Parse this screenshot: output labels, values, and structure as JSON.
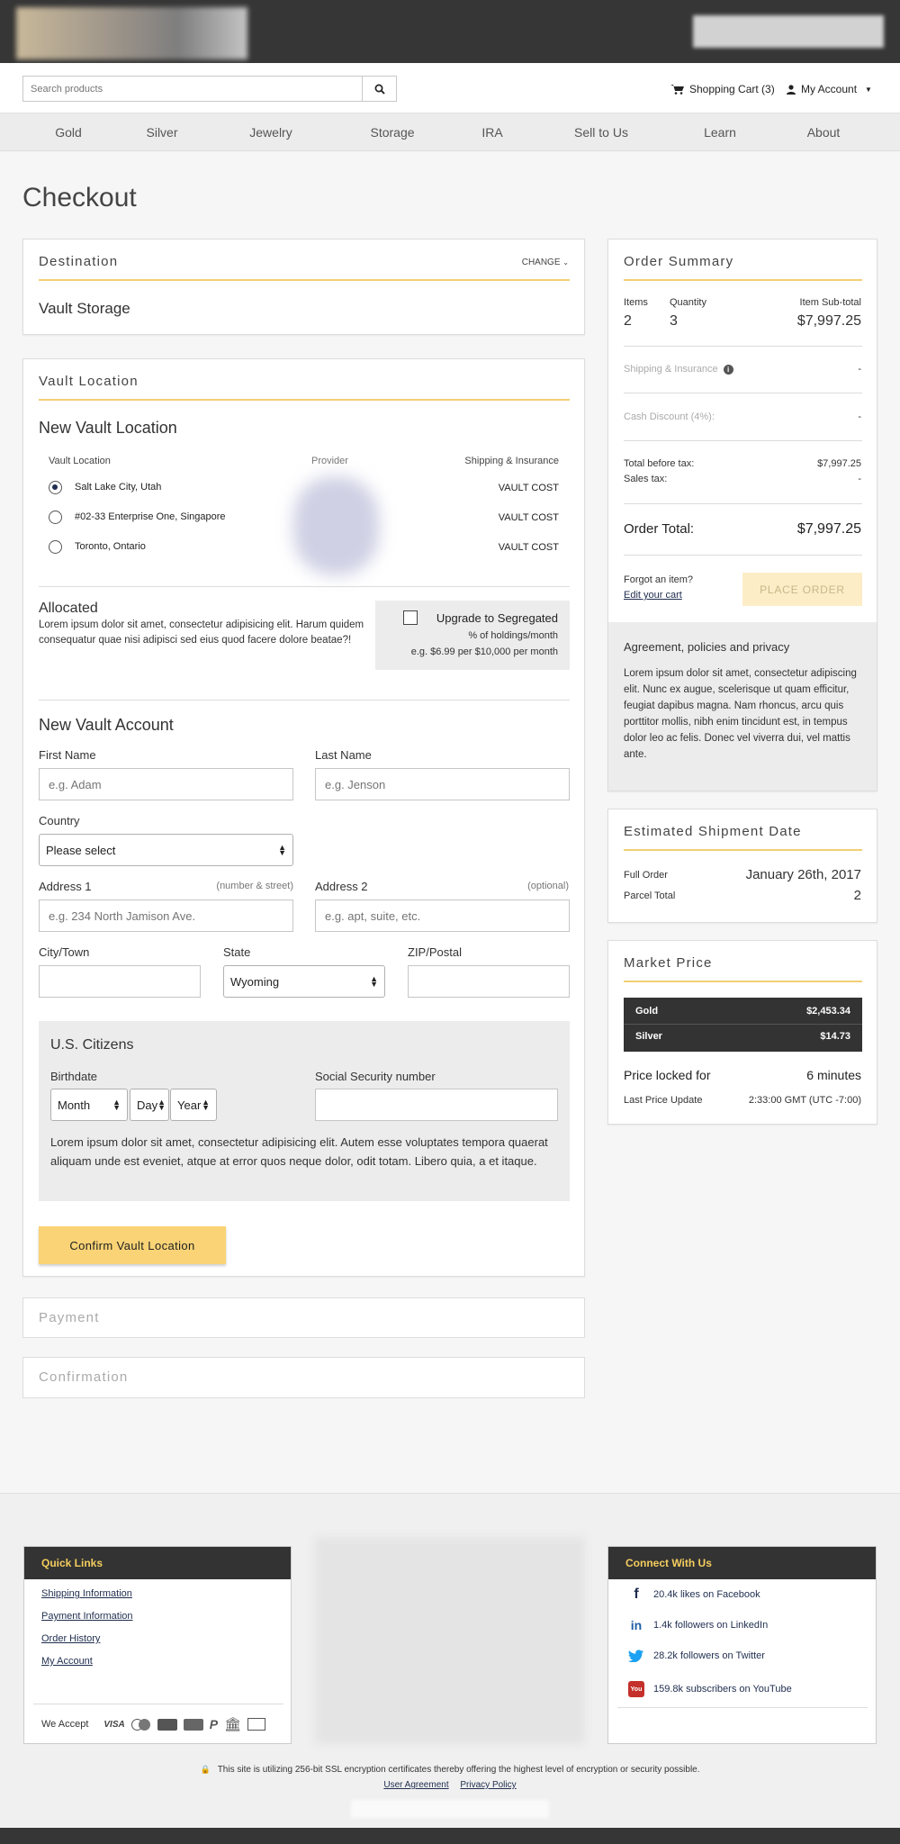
{
  "header": {
    "search_placeholder": "Search products",
    "cart_label": "Shopping Cart (3)",
    "account_label": "My Account"
  },
  "nav": [
    "Gold",
    "Silver",
    "Jewelry",
    "Storage",
    "IRA",
    "Sell to Us",
    "Learn",
    "About"
  ],
  "page_title": "Checkout",
  "destination": {
    "title": "Destination",
    "change_label": "CHANGE",
    "value": "Vault Storage"
  },
  "vault": {
    "title": "Vault Location",
    "subtitle": "New Vault Location",
    "col_location": "Vault Location",
    "col_provider": "Provider",
    "col_shipping": "Shipping & Insurance",
    "locations": [
      {
        "name": "Salt Lake City, Utah",
        "cost": "VAULT COST",
        "selected": true
      },
      {
        "name": "#02-33 Enterprise One, Singapore",
        "cost": "VAULT COST",
        "selected": false
      },
      {
        "name": "Toronto, Ontario",
        "cost": "VAULT COST",
        "selected": false
      }
    ],
    "allocated_title": "Allocated",
    "allocated_text": "Lorem ipsum dolor sit amet, consectetur adipisicing elit. Harum quidem consequatur quae nisi adipisci sed eius quod facere dolore beatae?!",
    "upgrade_label": "Upgrade to Segregated",
    "upgrade_line1": "% of holdings/month",
    "upgrade_line2": "e.g. $6.99 per $10,000 per month"
  },
  "account": {
    "title": "New Vault Account",
    "first_name_label": "First Name",
    "first_name_placeholder": "e.g. Adam",
    "last_name_label": "Last Name",
    "last_name_placeholder": "e.g. Jenson",
    "country_label": "Country",
    "country_value": "Please select",
    "address1_label": "Address 1",
    "address1_hint": "(number & street)",
    "address1_placeholder": "e.g. 234 North Jamison Ave.",
    "address2_label": "Address 2",
    "address2_hint": "(optional)",
    "address2_placeholder": "e.g. apt, suite, etc.",
    "city_label": "City/Town",
    "state_label": "State",
    "state_value": "Wyoming",
    "zip_label": "ZIP/Postal"
  },
  "citizens": {
    "title": "U.S. Citizens",
    "birthdate_label": "Birthdate",
    "month": "Month",
    "day": "Day",
    "year": "Year",
    "ssn_label": "Social Security number",
    "text": "Lorem ipsum dolor sit amet, consectetur adipisicing elit. Autem esse voluptates tempora quaerat aliquam unde est eveniet, atque at error quos neque dolor, odit totam. Libero quia, a et itaque."
  },
  "confirm_button": "Confirm Vault Location",
  "payment_title": "Payment",
  "confirmation_title": "Confirmation",
  "summary": {
    "title": "Order Summary",
    "items_label": "Items",
    "items_value": "2",
    "quantity_label": "Quantity",
    "quantity_value": "3",
    "subtotal_label": "Item Sub-total",
    "subtotal_value": "$7,997.25",
    "shipping_label": "Shipping & Insurance",
    "shipping_value": "-",
    "discount_label": "Cash Discount (4%):",
    "discount_value": "-",
    "before_tax_label": "Total before tax:",
    "before_tax_value": "$7,997.25",
    "sales_tax_label": "Sales tax:",
    "sales_tax_value": "-",
    "order_total_label": "Order Total:",
    "order_total_value": "$7,997.25",
    "forgot_label": "Forgot an item?",
    "edit_cart_label": "Edit your cart",
    "place_order_label": "PLACE ORDER",
    "agreement_title": "Agreement, policies and privacy",
    "agreement_text": "Lorem ipsum dolor sit amet, consectetur adipiscing elit. Nunc ex augue, scelerisque ut quam efficitur, feugiat dapibus magna. Nam rhoncus, arcu quis porttitor mollis, nibh enim tincidunt est, in tempus dolor leo ac felis. Donec vel viverra dui, vel mattis ante."
  },
  "shipment": {
    "title": "Estimated Shipment Date",
    "full_order_label": "Full Order",
    "full_order_value": "January 26th, 2017",
    "parcel_label": "Parcel Total",
    "parcel_value": "2"
  },
  "market": {
    "title": "Market Price",
    "gold_label": "Gold",
    "gold_value": "$2,453.34",
    "silver_label": "Silver",
    "silver_value": "$14.73",
    "locked_label": "Price locked for",
    "locked_value": "6 minutes",
    "update_label": "Last Price Update",
    "update_value": "2:33:00 GMT (UTC -7:00)"
  },
  "footer": {
    "quick_links_title": "Quick Links",
    "links": [
      "Shipping Information",
      "Payment Information",
      "Order History",
      "My Account"
    ],
    "we_accept": "We Accept",
    "visa": "VISA",
    "connect_title": "Connect With Us",
    "social": [
      "20.4k likes on Facebook",
      "1.4k followers on LinkedIn",
      "28.2k followers on Twitter",
      "159.8k subscribers on YouTube"
    ],
    "ssl_text": "This site is utilizing 256-bit SSL encryption certificates thereby offering the highest level of encryption or security possible.",
    "user_agreement": "User Agreement",
    "privacy_policy": "Privacy Policy"
  },
  "colors": {
    "accent": "#f4cd5e",
    "dark": "#333333",
    "navy": "#1f2d4e"
  }
}
